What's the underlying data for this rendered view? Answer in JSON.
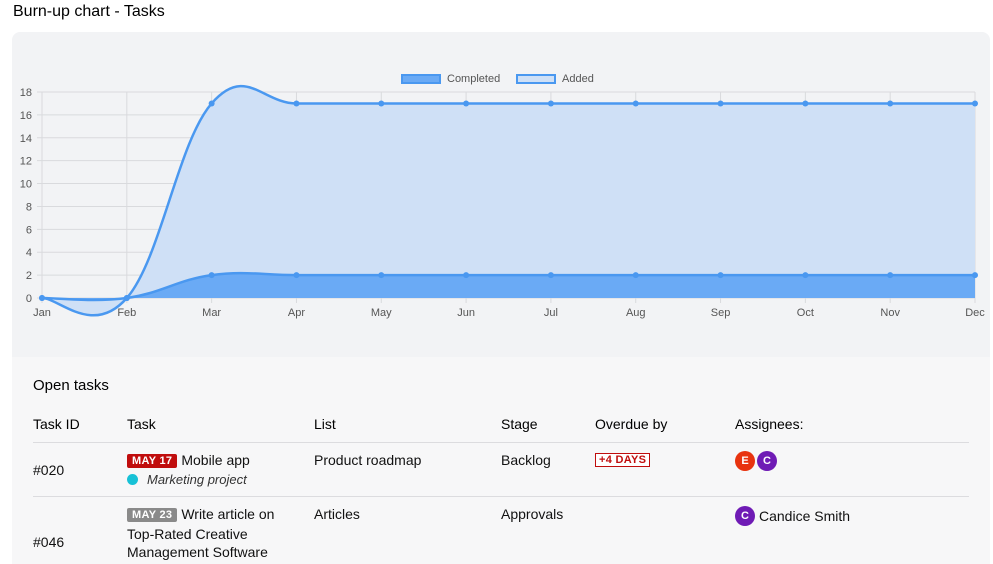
{
  "page": {
    "title": "Burn-up chart - Tasks"
  },
  "chart_data": {
    "type": "area",
    "x": [
      "Jan",
      "Feb",
      "Mar",
      "Apr",
      "May",
      "Jun",
      "Jul",
      "Aug",
      "Sep",
      "Oct",
      "Nov",
      "Dec"
    ],
    "series": [
      {
        "name": "Completed",
        "values": [
          0,
          0,
          2,
          2,
          2,
          2,
          2,
          2,
          2,
          2,
          2,
          2
        ],
        "color": "#6aaaf5"
      },
      {
        "name": "Added",
        "values": [
          0,
          0,
          17,
          17,
          17,
          17,
          17,
          17,
          17,
          17,
          17,
          17
        ],
        "color": "#cfe0f6"
      }
    ],
    "yticks": [
      0,
      2,
      4,
      6,
      8,
      10,
      12,
      14,
      16,
      18
    ],
    "ylim": [
      0,
      18
    ],
    "line_color": "#4a98f0",
    "grid": true,
    "legend": "top-center"
  },
  "tasks": {
    "title": "Open tasks",
    "headers": {
      "id": "Task ID",
      "task": "Task",
      "list": "List",
      "stage": "Stage",
      "overdue": "Overdue by",
      "assignees": "Assignees:"
    },
    "rows": [
      {
        "id": "#020",
        "date": "MAY 17",
        "date_color": "#c00d0d",
        "name": "Mobile app",
        "project": "Marketing project",
        "list": "Product roadmap",
        "stage": "Backlog",
        "overdue": "+4 DAYS",
        "avatars": [
          {
            "initial": "E",
            "color": "#e8330f"
          },
          {
            "initial": "C",
            "color": "#6f1bb5"
          }
        ]
      },
      {
        "id": "#046",
        "date": "MAY 23",
        "date_color": "#8a8a8a",
        "name_line1": "Write article on",
        "name_line2": "Top-Rated Creative",
        "name_line3": "Management Software",
        "list": "Articles",
        "stage": "Approvals",
        "avatars": [
          {
            "initial": "C",
            "color": "#6f1bb5"
          }
        ],
        "assignee_name": "Candice Smith"
      }
    ]
  }
}
